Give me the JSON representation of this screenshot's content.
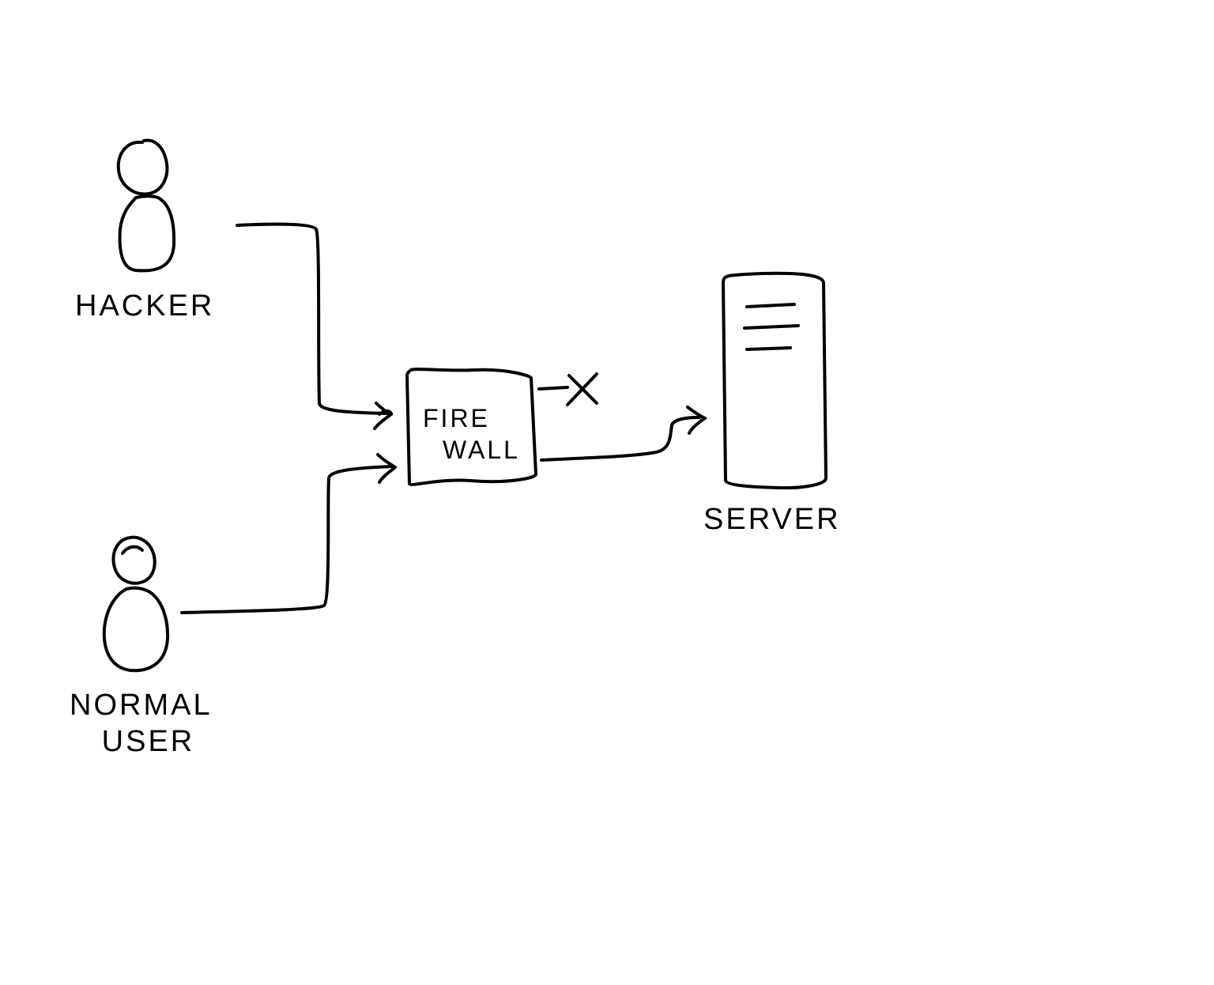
{
  "diagram": {
    "nodes": {
      "hacker": {
        "label": "HACKER"
      },
      "normal_user": {
        "label": "NORMAL\n   USER"
      },
      "firewall": {
        "label_line1": "FIRE",
        "label_line2": "WALL"
      },
      "server": {
        "label": "SERVER"
      }
    },
    "edges": {
      "hacker_to_firewall": {
        "type": "arrow"
      },
      "normal_user_to_firewall": {
        "type": "arrow"
      },
      "firewall_blocked": {
        "type": "blocked",
        "marker": "X"
      },
      "firewall_to_server": {
        "type": "arrow"
      }
    }
  }
}
